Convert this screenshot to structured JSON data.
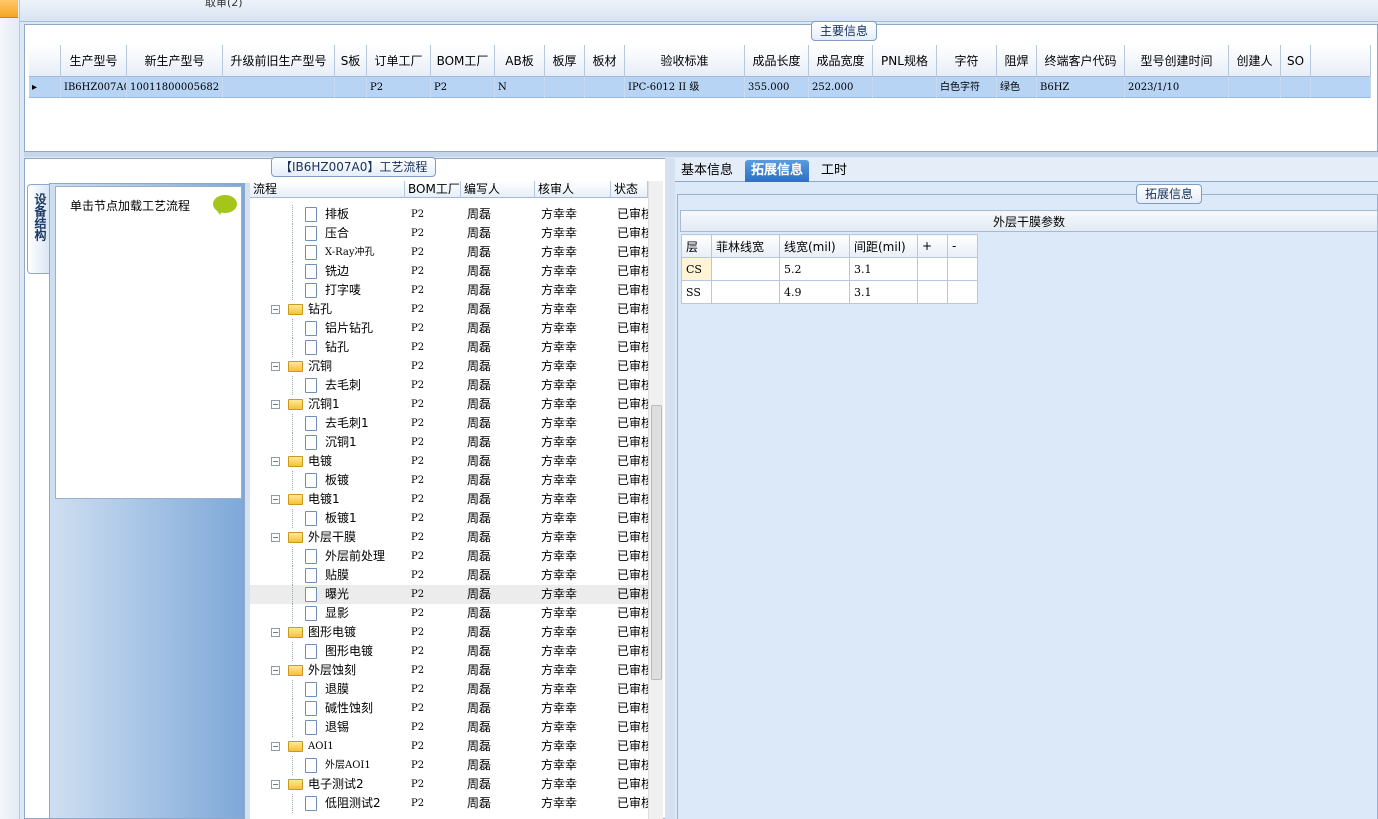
{
  "topbar": {
    "partial_text": "取审(2)"
  },
  "main": {
    "group_label": "主要信息",
    "columns": [
      "",
      "生产型号",
      "新生产型号",
      "升级前旧生产型号",
      "S板",
      "订单工厂",
      "BOM工厂",
      "AB板",
      "板厚",
      "板材",
      "验收标准",
      "成品长度",
      "成品宽度",
      "PNL规格",
      "字符",
      "阻焊",
      "终端客户代码",
      "型号创建时间",
      "创建人",
      "SO",
      ""
    ],
    "row": [
      "▸",
      "IB6HZ007A0",
      "10011800005682",
      "",
      "",
      "P2",
      "P2",
      "N",
      "",
      "",
      "IPC-6012 II 级",
      "355.000",
      "252.000",
      "",
      "白色字符",
      "绿色",
      "B6HZ",
      "2023/1/10",
      "",
      "",
      ""
    ]
  },
  "process": {
    "group_label": "【IB6HZ007A0】工艺流程",
    "vertical_tab": "设备结构",
    "nav_hint": "单击节点加载工艺流程",
    "columns": [
      "流程",
      "BOM工厂",
      "编写人",
      "核审人",
      "状态"
    ],
    "rows": [
      {
        "name": "排板",
        "level": 2,
        "factory": "P2",
        "writer": "周磊",
        "reviewer": "方幸幸",
        "status": "已审核"
      },
      {
        "name": "压合",
        "level": 2,
        "factory": "P2",
        "writer": "周磊",
        "reviewer": "方幸幸",
        "status": "已审核"
      },
      {
        "name": "X-Ray冲孔",
        "level": 2,
        "factory": "P2",
        "writer": "周磊",
        "reviewer": "方幸幸",
        "status": "已审核"
      },
      {
        "name": "铣边",
        "level": 2,
        "factory": "P2",
        "writer": "周磊",
        "reviewer": "方幸幸",
        "status": "已审核"
      },
      {
        "name": "打字唛",
        "level": 2,
        "factory": "P2",
        "writer": "周磊",
        "reviewer": "方幸幸",
        "status": "已审核"
      },
      {
        "name": "钻孔",
        "level": 1,
        "factory": "P2",
        "writer": "周磊",
        "reviewer": "方幸幸",
        "status": "已审核"
      },
      {
        "name": "铝片钻孔",
        "level": 2,
        "factory": "P2",
        "writer": "周磊",
        "reviewer": "方幸幸",
        "status": "已审核"
      },
      {
        "name": "钻孔",
        "level": 2,
        "factory": "P2",
        "writer": "周磊",
        "reviewer": "方幸幸",
        "status": "已审核"
      },
      {
        "name": "沉铜",
        "level": 1,
        "factory": "P2",
        "writer": "周磊",
        "reviewer": "方幸幸",
        "status": "已审核"
      },
      {
        "name": "去毛刺",
        "level": 2,
        "factory": "P2",
        "writer": "周磊",
        "reviewer": "方幸幸",
        "status": "已审核"
      },
      {
        "name": "沉铜1",
        "level": 1,
        "factory": "P2",
        "writer": "周磊",
        "reviewer": "方幸幸",
        "status": "已审核"
      },
      {
        "name": "去毛刺1",
        "level": 2,
        "factory": "P2",
        "writer": "周磊",
        "reviewer": "方幸幸",
        "status": "已审核"
      },
      {
        "name": "沉铜1",
        "level": 2,
        "factory": "P2",
        "writer": "周磊",
        "reviewer": "方幸幸",
        "status": "已审核"
      },
      {
        "name": "电镀",
        "level": 1,
        "factory": "P2",
        "writer": "周磊",
        "reviewer": "方幸幸",
        "status": "已审核"
      },
      {
        "name": "板镀",
        "level": 2,
        "factory": "P2",
        "writer": "周磊",
        "reviewer": "方幸幸",
        "status": "已审核"
      },
      {
        "name": "电镀1",
        "level": 1,
        "factory": "P2",
        "writer": "周磊",
        "reviewer": "方幸幸",
        "status": "已审核"
      },
      {
        "name": "板镀1",
        "level": 2,
        "factory": "P2",
        "writer": "周磊",
        "reviewer": "方幸幸",
        "status": "已审核"
      },
      {
        "name": "外层干膜",
        "level": 1,
        "factory": "P2",
        "writer": "周磊",
        "reviewer": "方幸幸",
        "status": "已审核"
      },
      {
        "name": "外层前处理",
        "level": 2,
        "factory": "P2",
        "writer": "周磊",
        "reviewer": "方幸幸",
        "status": "已审核"
      },
      {
        "name": "贴膜",
        "level": 2,
        "factory": "P2",
        "writer": "周磊",
        "reviewer": "方幸幸",
        "status": "已审核"
      },
      {
        "name": "曝光",
        "level": 2,
        "factory": "P2",
        "writer": "周磊",
        "reviewer": "方幸幸",
        "status": "已审核",
        "selected": true
      },
      {
        "name": "显影",
        "level": 2,
        "factory": "P2",
        "writer": "周磊",
        "reviewer": "方幸幸",
        "status": "已审核"
      },
      {
        "name": "图形电镀",
        "level": 1,
        "factory": "P2",
        "writer": "周磊",
        "reviewer": "方幸幸",
        "status": "已审核"
      },
      {
        "name": "图形电镀",
        "level": 2,
        "factory": "P2",
        "writer": "周磊",
        "reviewer": "方幸幸",
        "status": "已审核"
      },
      {
        "name": "外层蚀刻",
        "level": 1,
        "factory": "P2",
        "writer": "周磊",
        "reviewer": "方幸幸",
        "status": "已审核"
      },
      {
        "name": "退膜",
        "level": 2,
        "factory": "P2",
        "writer": "周磊",
        "reviewer": "方幸幸",
        "status": "已审核"
      },
      {
        "name": "碱性蚀刻",
        "level": 2,
        "factory": "P2",
        "writer": "周磊",
        "reviewer": "方幸幸",
        "status": "已审核"
      },
      {
        "name": "退锡",
        "level": 2,
        "factory": "P2",
        "writer": "周磊",
        "reviewer": "方幸幸",
        "status": "已审核"
      },
      {
        "name": "AOI1",
        "level": 1,
        "factory": "P2",
        "writer": "周磊",
        "reviewer": "方幸幸",
        "status": "已审核"
      },
      {
        "name": "外层AOI1",
        "level": 2,
        "factory": "P2",
        "writer": "周磊",
        "reviewer": "方幸幸",
        "status": "已审核"
      },
      {
        "name": "电子测试2",
        "level": 1,
        "factory": "P2",
        "writer": "周磊",
        "reviewer": "方幸幸",
        "status": "已审核"
      },
      {
        "name": "低阻测试2",
        "level": 2,
        "factory": "P2",
        "writer": "周磊",
        "reviewer": "方幸幸",
        "status": "已审核"
      }
    ]
  },
  "right": {
    "tabs": [
      "基本信息",
      "拓展信息",
      "工时"
    ],
    "active_tab": 1,
    "group_label": "拓展信息",
    "table_title": "外层干膜参数",
    "columns": [
      "层",
      "菲林线宽",
      "线宽(mil)",
      "间距(mil)",
      "+",
      "-"
    ],
    "rows": [
      [
        "CS",
        "",
        "5.2",
        "3.1",
        "",
        ""
      ],
      [
        "SS",
        "",
        "4.9",
        "3.1",
        "",
        ""
      ]
    ]
  }
}
